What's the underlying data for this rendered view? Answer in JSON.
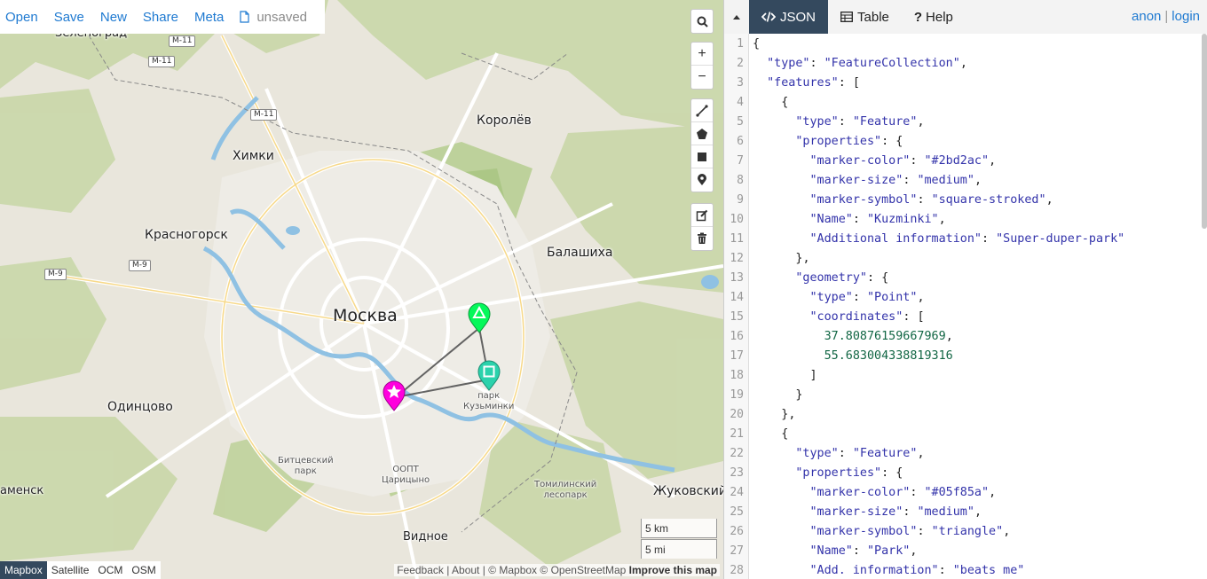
{
  "toolbar": {
    "open": "Open",
    "save": "Save",
    "new": "New",
    "share": "Share",
    "meta": "Meta",
    "unsaved": "unsaved"
  },
  "map": {
    "places": {
      "zelenograd": "Зеленоград",
      "khimki": "Химки",
      "korolev": "Королёв",
      "krasnogorsk": "Красногорск",
      "balashikha": "Балашиха",
      "moskva": "Москва",
      "odintsovo": "Одинцово",
      "park_kuzminki": "парк\nКузьминки",
      "bitsevsky": "Битцевский\nпарк",
      "oopt": "ООПТ\nЦарицыно",
      "tomilinsky": "Томилинский\nлесопарк",
      "zhukovsky": "Жуковский",
      "vidnoe": "Видное",
      "znamensk": "аменск"
    },
    "shields": [
      "М-11",
      "М-11",
      "М-11",
      "М-9",
      "М-9"
    ],
    "scale_km": "5 km",
    "scale_mi": "5 mi",
    "layers": [
      "Mapbox",
      "Satellite",
      "OCM",
      "OSM"
    ],
    "active_layer": "Mapbox",
    "attribution": {
      "feedback": "Feedback",
      "about": "About",
      "mapbox": "© Mapbox",
      "osm": "© OpenStreetMap",
      "improve": "Improve this map"
    },
    "markers": [
      {
        "color": "#05f85a",
        "symbol": "triangle"
      },
      {
        "color": "#2bd2ac",
        "symbol": "square-stroked"
      },
      {
        "color": "#ff00dd",
        "symbol": "star"
      }
    ]
  },
  "pane": {
    "collapse_icon": "triangle-up",
    "tabs": [
      {
        "id": "json",
        "label": "JSON",
        "icon": "code-icon"
      },
      {
        "id": "table",
        "label": "Table",
        "icon": "table-icon"
      },
      {
        "id": "help",
        "label": "Help",
        "icon": "question-icon"
      }
    ],
    "active_tab": "JSON",
    "user": {
      "anon": "anon",
      "sep": "|",
      "login": "login"
    },
    "code_lines": [
      "{",
      "  \"type\": \"FeatureCollection\",",
      "  \"features\": [",
      "    {",
      "      \"type\": \"Feature\",",
      "      \"properties\": {",
      "        \"marker-color\": \"#2bd2ac\",",
      "        \"marker-size\": \"medium\",",
      "        \"marker-symbol\": \"square-stroked\",",
      "        \"Name\": \"Kuzminki\",",
      "        \"Additional information\": \"Super-duper-park\"",
      "      },",
      "      \"geometry\": {",
      "        \"type\": \"Point\",",
      "        \"coordinates\": [",
      "          37.80876159667969,",
      "          55.683004338819316",
      "        ]",
      "      }",
      "    },",
      "    {",
      "      \"type\": \"Feature\",",
      "      \"properties\": {",
      "        \"marker-color\": \"#05f85a\",",
      "        \"marker-size\": \"medium\",",
      "        \"marker-symbol\": \"triangle\",",
      "        \"Name\": \"Park\",",
      "        \"Add. information\": \"beats me\""
    ]
  }
}
